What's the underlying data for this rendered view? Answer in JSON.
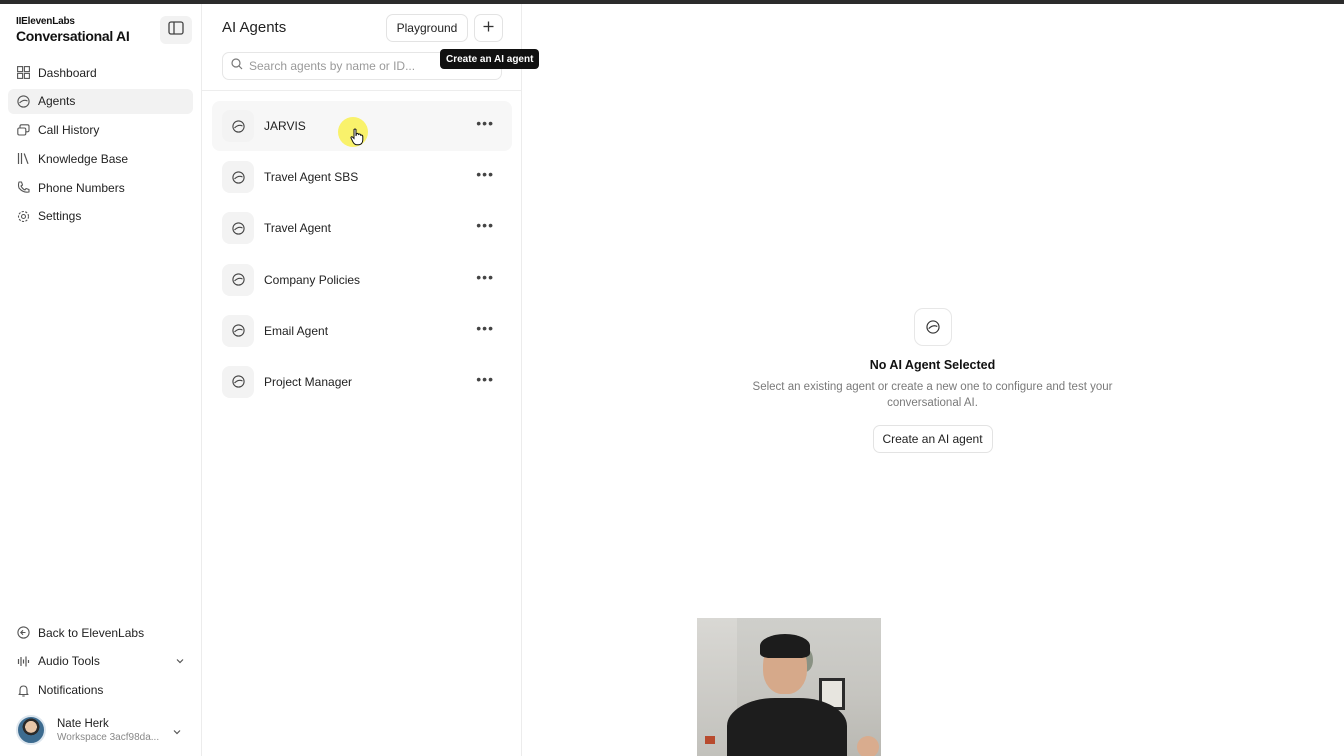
{
  "sidebar": {
    "brand_small": "IIElevenLabs",
    "brand_title": "Conversational AI",
    "nav": [
      {
        "label": "Dashboard",
        "icon": "grid-icon",
        "active": false
      },
      {
        "label": "Agents",
        "icon": "agent-icon",
        "active": true
      },
      {
        "label": "Call History",
        "icon": "chat-icon",
        "active": false
      },
      {
        "label": "Knowledge Base",
        "icon": "books-icon",
        "active": false
      },
      {
        "label": "Phone Numbers",
        "icon": "phone-icon",
        "active": false
      },
      {
        "label": "Settings",
        "icon": "gear-icon",
        "active": false
      }
    ],
    "bottom": {
      "back": "Back to ElevenLabs",
      "audio_tools": "Audio Tools",
      "notifications": "Notifications"
    },
    "user": {
      "name": "Nate Herk",
      "workspace": "Workspace 3acf98da..."
    }
  },
  "agents_panel": {
    "title": "AI Agents",
    "playground_label": "Playground",
    "add_icon": "plus-icon",
    "tooltip": "Create an AI agent",
    "search_placeholder": "Search agents by name or ID...",
    "agents": [
      {
        "name": "JARVIS"
      },
      {
        "name": "Travel Agent SBS"
      },
      {
        "name": "Travel Agent"
      },
      {
        "name": "Company Policies"
      },
      {
        "name": "Email Agent"
      },
      {
        "name": "Project Manager"
      }
    ]
  },
  "main": {
    "empty_title": "No AI Agent Selected",
    "empty_desc": "Select an existing agent or create a new one to configure and test your conversational AI.",
    "create_label": "Create an AI agent"
  },
  "colors": {
    "active_bg": "#f2f2f2",
    "tooltip_bg": "#111111",
    "cursor_highlight": "#faf03c"
  }
}
